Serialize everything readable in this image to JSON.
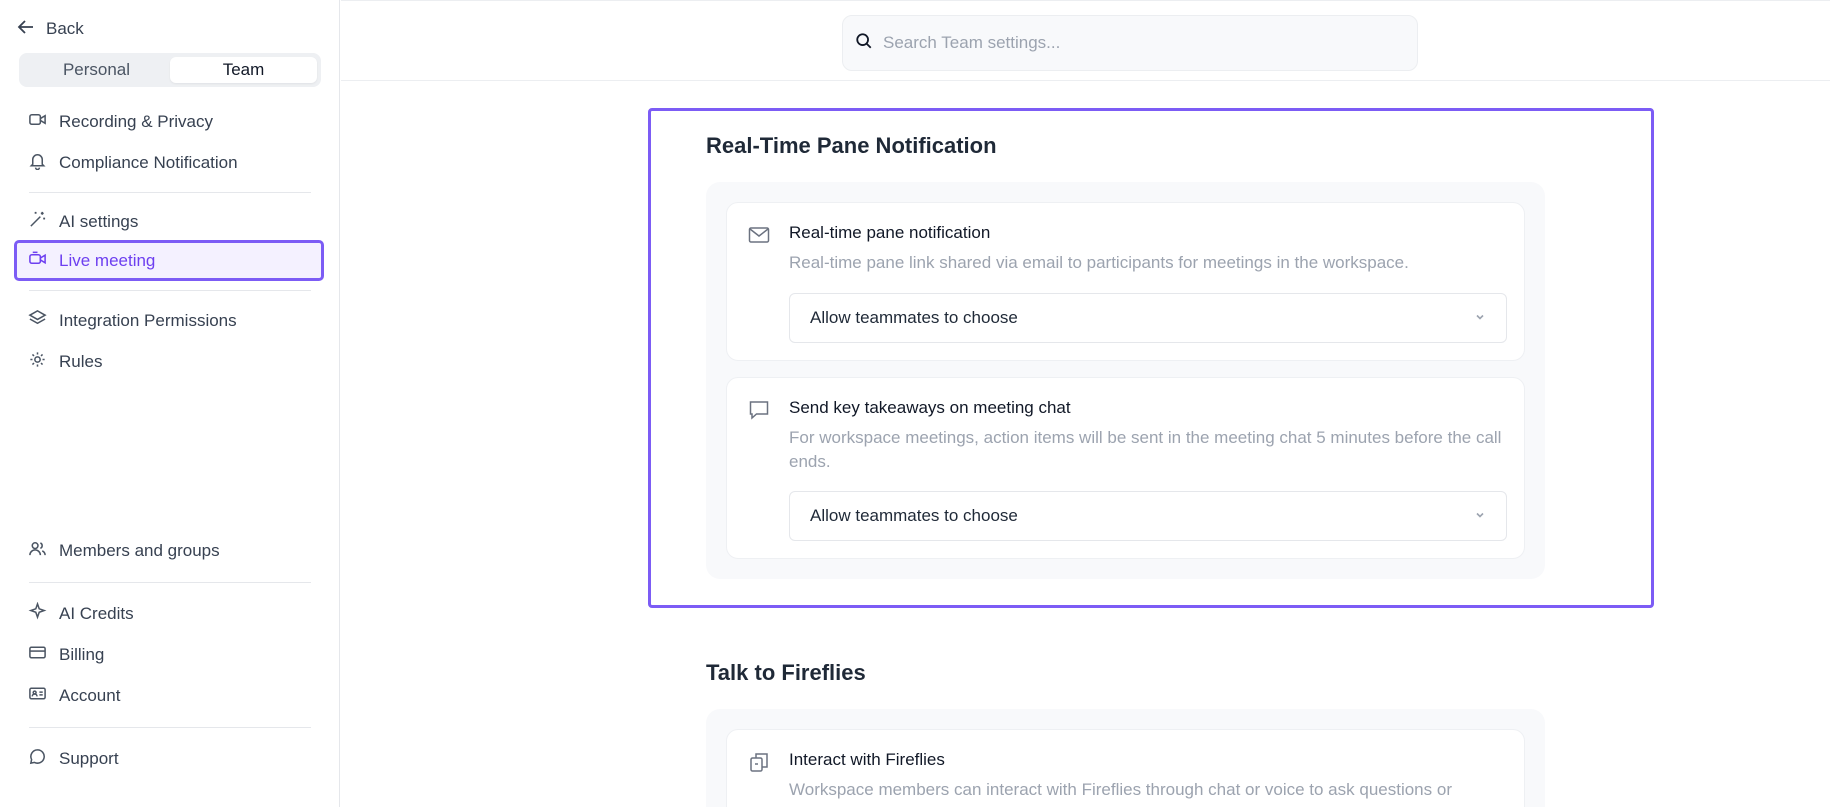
{
  "sidebar": {
    "back_label": "Back",
    "switch": {
      "personal": "Personal",
      "team": "Team",
      "selected": "Team"
    },
    "items": {
      "recording": "Recording & Privacy",
      "compliance": "Compliance Notification",
      "ai_settings": "AI settings",
      "live_meeting": "Live meeting",
      "integration": "Integration Permissions",
      "rules": "Rules",
      "members": "Members and groups",
      "ai_credits": "AI Credits",
      "billing": "Billing",
      "account": "Account",
      "support": "Support"
    },
    "active_item": "Live meeting",
    "accent_color": "#7c5cf5"
  },
  "search": {
    "placeholder": "Search Team settings...",
    "value": ""
  },
  "main": {
    "sections": [
      {
        "title": "Real-Time Pane Notification",
        "settings": [
          {
            "icon": "mail-icon",
            "title": "Real-time pane notification",
            "description": "Real-time pane link shared via email to participants for meetings in the workspace.",
            "selected": "Allow teammates to choose"
          },
          {
            "icon": "chat-icon",
            "title": "Send key takeaways on meeting chat",
            "description": "For workspace meetings, action items will be sent in the meeting chat 5 minutes before the call ends.",
            "selected": "Allow teammates to choose"
          }
        ]
      },
      {
        "title": "Talk to Fireflies",
        "settings": [
          {
            "icon": "interact-icon",
            "title": "Interact with Fireflies",
            "description": "Workspace members can interact with Fireflies through chat or voice to ask questions or"
          }
        ]
      }
    ]
  }
}
